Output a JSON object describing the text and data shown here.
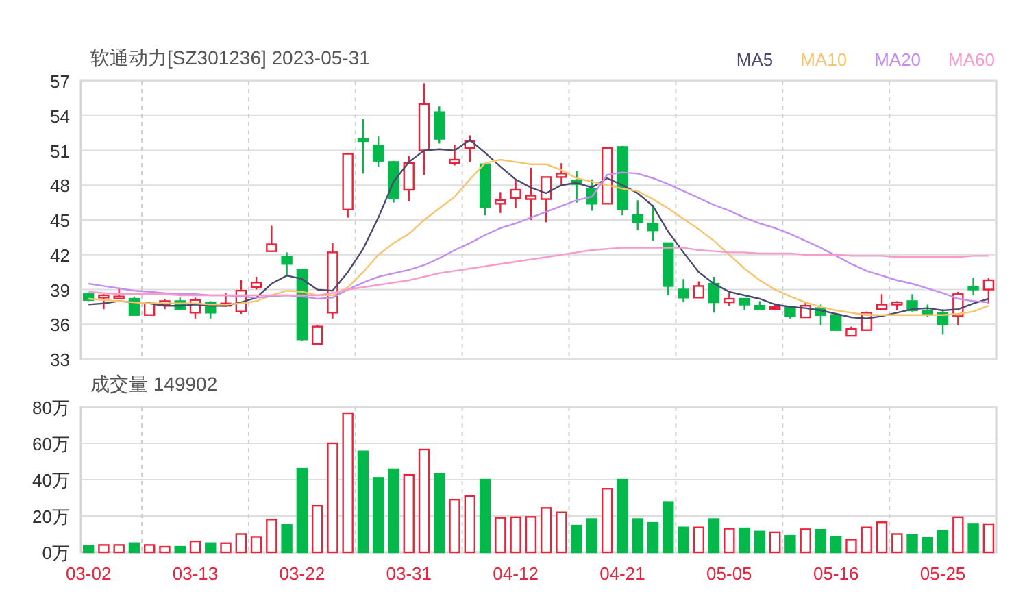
{
  "price_chart": {
    "chart_data": {
      "type": "candlestick",
      "title": "软通动力[SZ301236] 2023-05-31",
      "ylim": [
        33,
        57
      ],
      "yticks": [
        33,
        36,
        39,
        42,
        45,
        48,
        51,
        54,
        57
      ],
      "grid": true,
      "ohlc": [
        [
          38.6,
          38.7,
          38.0,
          38.1
        ],
        [
          38.3,
          38.6,
          37.3,
          38.5
        ],
        [
          38.3,
          39.1,
          38.2,
          38.4
        ],
        [
          38.2,
          38.4,
          36.8,
          36.8
        ],
        [
          36.8,
          37.9,
          36.8,
          37.8
        ],
        [
          37.7,
          38.2,
          37.3,
          38.0
        ],
        [
          38.0,
          38.3,
          37.2,
          37.3
        ],
        [
          37.0,
          38.3,
          36.5,
          38.1
        ],
        [
          37.9,
          38.0,
          36.5,
          37.0
        ],
        [
          37.6,
          38.7,
          37.5,
          37.8
        ],
        [
          37.1,
          39.8,
          36.9,
          38.9
        ],
        [
          39.2,
          40.1,
          39.0,
          39.6
        ],
        [
          42.3,
          44.5,
          42.3,
          42.9
        ],
        [
          41.8,
          42.2,
          40.1,
          41.2
        ],
        [
          40.7,
          40.7,
          34.6,
          34.7
        ],
        [
          34.3,
          35.9,
          34.3,
          35.8
        ],
        [
          37.0,
          43.0,
          36.5,
          42.2
        ],
        [
          45.9,
          50.8,
          45.2,
          50.7
        ],
        [
          52.0,
          53.7,
          49.0,
          51.8
        ],
        [
          51.4,
          52.2,
          49.6,
          50.1
        ],
        [
          50.0,
          50.1,
          46.5,
          46.9
        ],
        [
          47.6,
          50.5,
          46.6,
          49.9
        ],
        [
          51.0,
          56.8,
          48.9,
          55.0
        ],
        [
          54.3,
          54.8,
          51.6,
          52.0
        ],
        [
          49.9,
          51.5,
          49.7,
          50.2
        ],
        [
          51.2,
          52.3,
          50.0,
          51.8
        ],
        [
          49.8,
          49.8,
          45.4,
          46.1
        ],
        [
          46.4,
          47.4,
          45.6,
          46.7
        ],
        [
          46.9,
          48.5,
          46.0,
          47.6
        ],
        [
          46.8,
          49.5,
          45.0,
          47.1
        ],
        [
          46.8,
          48.7,
          44.8,
          48.7
        ],
        [
          48.7,
          49.9,
          48.0,
          49.0
        ],
        [
          48.4,
          49.2,
          46.5,
          48.1
        ],
        [
          47.7,
          48.5,
          45.8,
          46.4
        ],
        [
          46.4,
          51.2,
          46.4,
          51.2
        ],
        [
          51.3,
          51.4,
          45.4,
          45.9
        ],
        [
          45.4,
          46.7,
          44.1,
          44.8
        ],
        [
          44.7,
          46.3,
          43.2,
          44.1
        ],
        [
          43.0,
          43.0,
          38.5,
          39.3
        ],
        [
          39.0,
          39.9,
          37.9,
          38.3
        ],
        [
          38.3,
          39.7,
          38.3,
          39.3
        ],
        [
          39.5,
          40.1,
          37.0,
          37.9
        ],
        [
          37.9,
          38.7,
          37.6,
          38.2
        ],
        [
          38.2,
          38.2,
          37.2,
          37.7
        ],
        [
          37.6,
          38.0,
          37.2,
          37.3
        ],
        [
          37.4,
          37.8,
          37.2,
          37.5
        ],
        [
          37.5,
          37.5,
          36.5,
          36.7
        ],
        [
          36.6,
          37.9,
          36.6,
          37.6
        ],
        [
          37.4,
          37.7,
          35.9,
          36.8
        ],
        [
          36.8,
          36.8,
          35.5,
          35.5
        ],
        [
          35.0,
          35.8,
          35.0,
          35.6
        ],
        [
          35.5,
          37.1,
          35.5,
          37.0
        ],
        [
          37.3,
          38.6,
          37.3,
          37.7
        ],
        [
          37.7,
          38.0,
          37.2,
          37.9
        ],
        [
          38.0,
          38.6,
          37.1,
          37.2
        ],
        [
          37.2,
          37.7,
          36.6,
          36.8
        ],
        [
          37.0,
          37.3,
          35.1,
          36.0
        ],
        [
          36.7,
          38.8,
          35.9,
          38.6
        ],
        [
          39.2,
          40.0,
          38.5,
          39.0
        ],
        [
          39.0,
          40.0,
          37.8,
          39.8
        ]
      ]
    }
  },
  "moving_averages": {
    "chart_data": {
      "type": "line",
      "ylim": [
        33,
        57
      ],
      "series": [
        {
          "name": "MA5",
          "color": "#4b4a6e",
          "values": [
            37.7,
            37.8,
            38.0,
            37.9,
            37.8,
            37.6,
            37.6,
            37.7,
            37.6,
            37.6,
            37.9,
            38.3,
            39.5,
            40.2,
            39.9,
            39.0,
            38.9,
            40.5,
            42.5,
            45.2,
            48.3,
            50.0,
            51.0,
            51.1,
            51.0,
            51.9,
            50.8,
            49.6,
            48.5,
            47.8,
            47.3,
            48.0,
            48.2,
            47.8,
            48.6,
            48.0,
            47.3,
            46.2,
            44.0,
            42.2,
            40.5,
            39.5,
            38.8,
            38.5,
            38.2,
            37.7,
            37.5,
            37.4,
            37.2,
            36.9,
            36.6,
            36.5,
            36.7,
            37.0,
            37.3,
            37.4,
            37.2,
            37.3,
            37.8,
            38.2
          ]
        },
        {
          "name": "MA10",
          "color": "#f7c46e",
          "values": [
            38.2,
            38.1,
            38.0,
            37.9,
            37.8,
            37.8,
            37.8,
            37.8,
            37.7,
            37.7,
            37.8,
            38.0,
            38.5,
            38.9,
            38.8,
            38.5,
            38.5,
            39.2,
            40.5,
            42.0,
            43.0,
            43.8,
            45.0,
            46.0,
            47.0,
            48.5,
            49.9,
            50.2,
            50.0,
            49.8,
            49.8,
            49.3,
            48.6,
            48.3,
            48.0,
            47.7,
            47.5,
            46.8,
            46.0,
            45.1,
            44.2,
            43.2,
            42.0,
            40.8,
            39.8,
            39.0,
            38.4,
            37.9,
            37.5,
            37.2,
            37.0,
            36.8,
            36.8,
            36.8,
            36.8,
            36.8,
            36.8,
            36.9,
            37.1,
            37.6
          ]
        },
        {
          "name": "MA20",
          "color": "#c48ef0",
          "values": [
            39.5,
            39.3,
            39.1,
            38.9,
            38.8,
            38.7,
            38.6,
            38.6,
            38.5,
            38.5,
            38.4,
            38.3,
            38.4,
            38.5,
            38.4,
            38.2,
            38.3,
            39.0,
            39.6,
            40.1,
            40.4,
            40.7,
            41.1,
            41.7,
            42.4,
            43.0,
            43.7,
            44.3,
            44.7,
            45.2,
            45.7,
            46.2,
            46.7,
            47.0,
            48.9,
            49.1,
            49.0,
            48.6,
            48.1,
            47.5,
            46.9,
            46.3,
            45.8,
            45.2,
            44.7,
            44.3,
            43.8,
            43.2,
            42.6,
            41.9,
            41.2,
            40.6,
            40.2,
            39.8,
            39.5,
            39.1,
            38.7,
            38.2,
            38.0,
            37.9
          ]
        },
        {
          "name": "MA60",
          "color": "#f89bcb",
          "values": [
            38.8,
            38.7,
            38.6,
            38.6,
            38.6,
            38.6,
            38.5,
            38.5,
            38.5,
            38.5,
            38.5,
            38.5,
            38.5,
            38.5,
            38.5,
            38.5,
            38.7,
            39.0,
            39.2,
            39.4,
            39.6,
            39.8,
            40.1,
            40.4,
            40.6,
            40.8,
            41.0,
            41.2,
            41.4,
            41.6,
            41.8,
            42.0,
            42.2,
            42.4,
            42.5,
            42.6,
            42.6,
            42.6,
            42.6,
            42.6,
            42.4,
            42.3,
            42.2,
            42.2,
            42.1,
            42.1,
            42.1,
            42.0,
            42.0,
            42.0,
            41.9,
            41.9,
            41.9,
            41.8,
            41.8,
            41.8,
            41.8,
            41.8,
            41.9,
            41.9
          ]
        }
      ]
    }
  },
  "volume_chart": {
    "chart_data": {
      "type": "bar",
      "title": "成交量 149902",
      "ylim": [
        0,
        80
      ],
      "grid": true,
      "yticks": [
        {
          "value": 0,
          "label": "0万"
        },
        {
          "value": 20,
          "label": "20万"
        },
        {
          "value": 40,
          "label": "40万"
        },
        {
          "value": 60,
          "label": "60万"
        },
        {
          "value": 80,
          "label": "80万"
        }
      ],
      "categories": [
        "03-02",
        null,
        null,
        null,
        null,
        null,
        null,
        "03-13",
        null,
        null,
        null,
        null,
        null,
        null,
        "03-22",
        null,
        null,
        null,
        null,
        null,
        null,
        "03-31",
        null,
        null,
        null,
        null,
        null,
        null,
        "04-12",
        null,
        null,
        null,
        null,
        null,
        null,
        "04-21",
        null,
        null,
        null,
        null,
        null,
        null,
        "05-05",
        null,
        null,
        null,
        null,
        null,
        null,
        "05-16",
        null,
        null,
        null,
        null,
        null,
        null,
        "05-25",
        null,
        null,
        null
      ],
      "series": [
        {
          "values": [
            3.5,
            4,
            4,
            5,
            4,
            3,
            3,
            6,
            5,
            5,
            10,
            8.5,
            18,
            15,
            46,
            25.6,
            60,
            76.6,
            55.6,
            41,
            45.7,
            42.6,
            56.6,
            43,
            29,
            31,
            40,
            19,
            19.3,
            19.5,
            24.4,
            22,
            14.7,
            18.3,
            35,
            40,
            18.3,
            16.2,
            27.7,
            13.7,
            13.7,
            18.3,
            13,
            13.2,
            11.4,
            11,
            9,
            12.7,
            12.4,
            8.6,
            7,
            13.7,
            16.5,
            10,
            9.4,
            7.9,
            12,
            19.3,
            15.7,
            15.5
          ]
        }
      ]
    }
  }
}
